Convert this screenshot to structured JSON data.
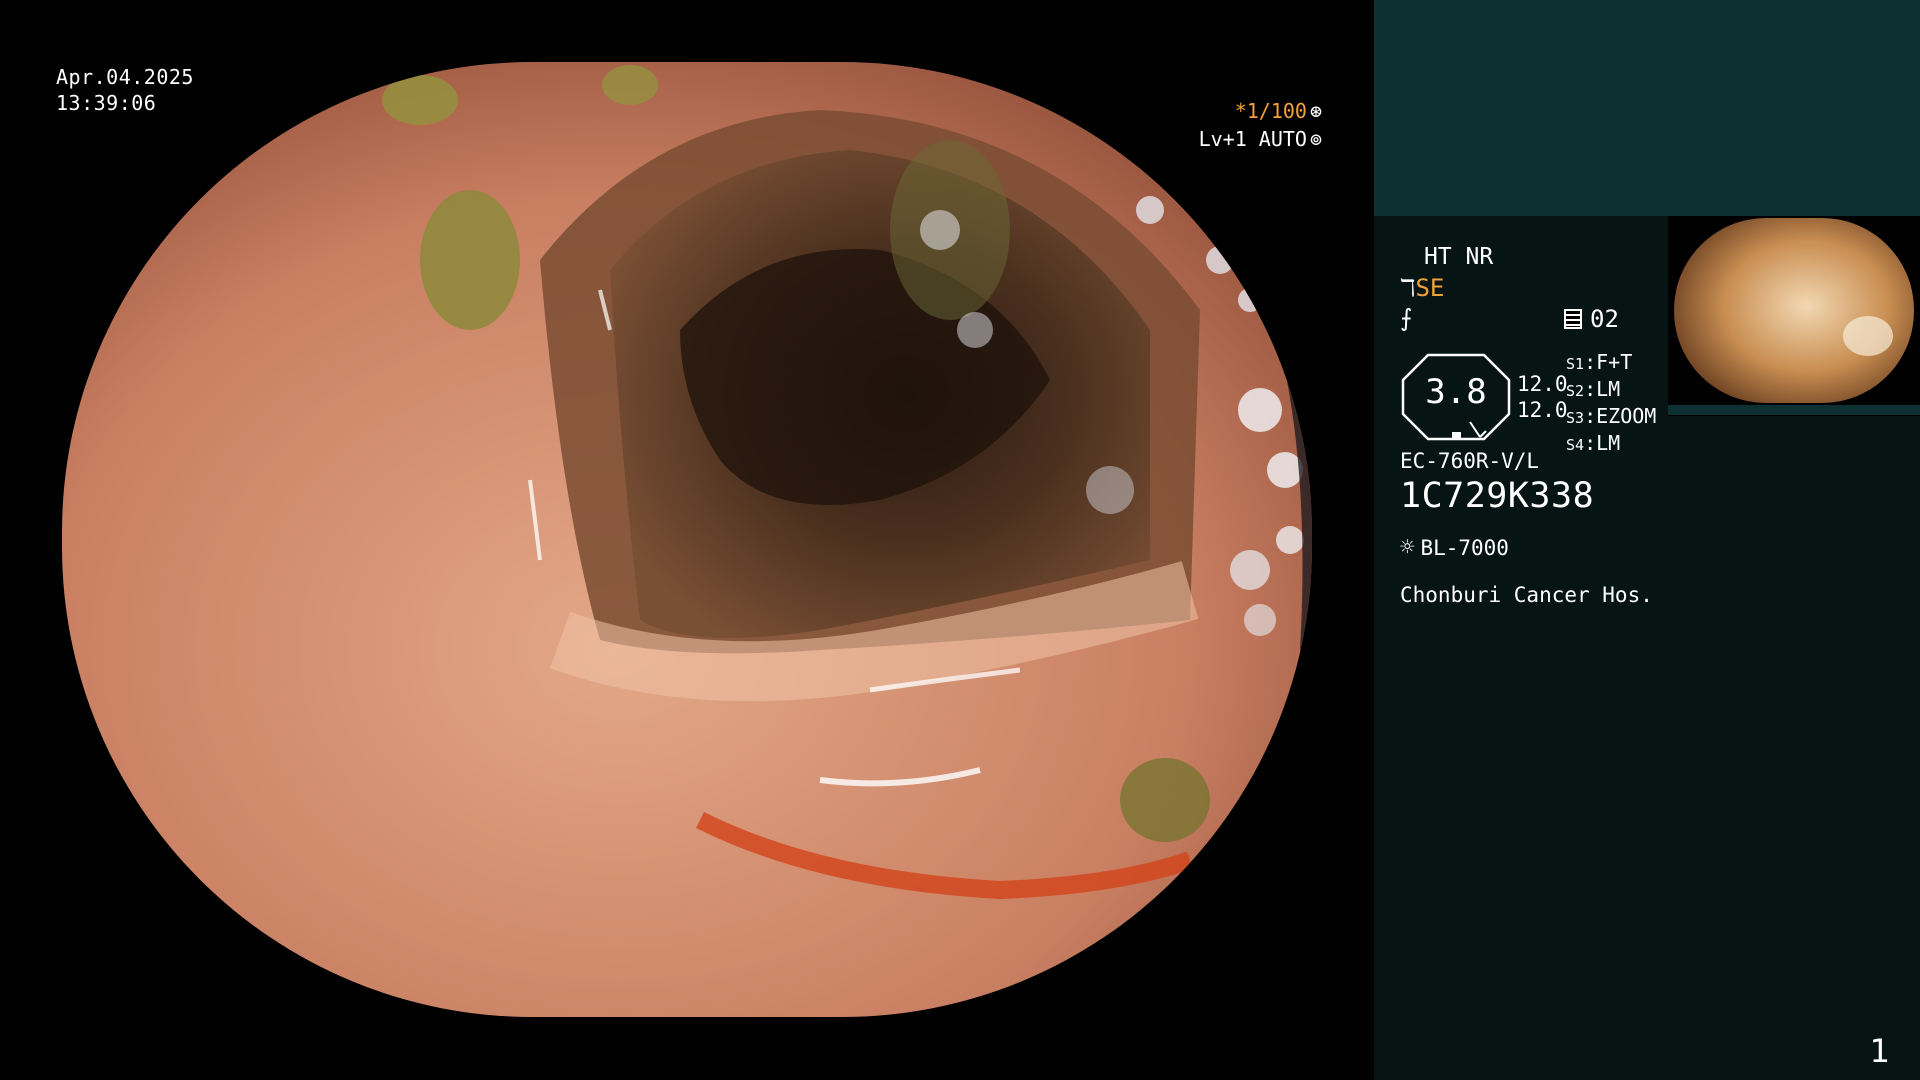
{
  "overlay": {
    "date": "Apr.04.2025",
    "time": "13:39:06",
    "shutter": "*1/100",
    "shutter_icon": "aperture-icon",
    "iris": "Lv+1 AUTO",
    "iris_icon": "iris-icon"
  },
  "side_panel": {
    "mode": "HT NR",
    "se_prefix": "ℸ",
    "se_label": "SE",
    "f_icon": "⨍",
    "memo_value": "02",
    "octagon_value": "3.8",
    "value_a": "12.0",
    "value_b": "12.0",
    "slots": [
      {
        "key": "S1",
        "value": "F+T"
      },
      {
        "key": "S2",
        "value": "LM"
      },
      {
        "key": "S3",
        "value": "EZOOM"
      },
      {
        "key": "S4",
        "value": "LM"
      }
    ],
    "scope_model": "EC-760R-V/L",
    "serial": "1C729K338",
    "light_source": "BL-7000",
    "hospital": "Chonburi Cancer Hos."
  },
  "page_number": "1",
  "colors": {
    "accent_orange": "#f2a23a",
    "panel_top": "#0d3033",
    "panel_bottom": "#071414"
  }
}
